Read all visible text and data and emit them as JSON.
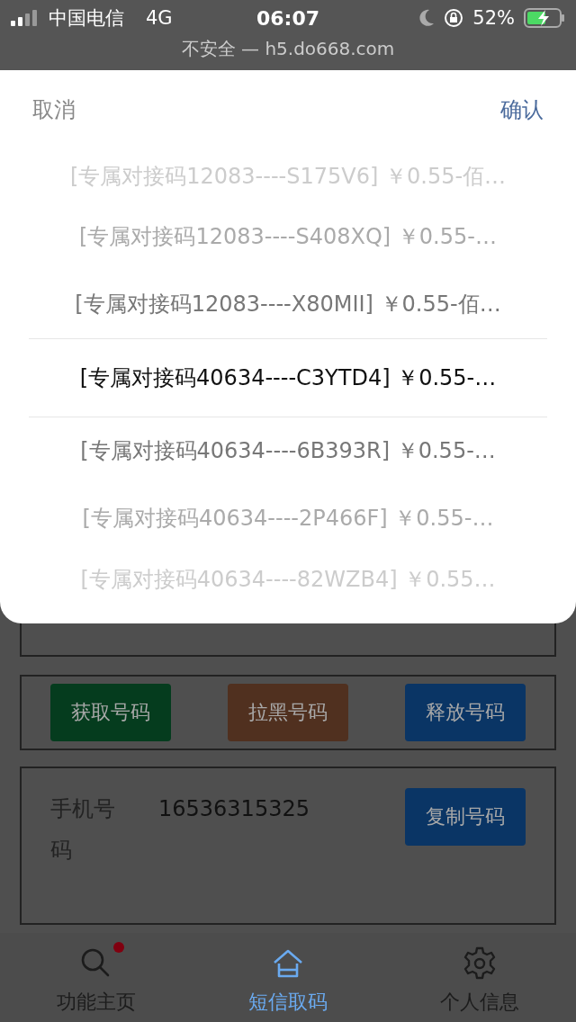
{
  "status_bar": {
    "carrier": "中国电信",
    "network": "4G",
    "time": "06:07",
    "battery": "52%"
  },
  "address_bar": {
    "text": "不安全 — h5.do668.com"
  },
  "picker": {
    "cancel": "取消",
    "confirm": "确认",
    "options": [
      {
        "label": "[专属对接码12083----S175V6] ￥0.55-佰…",
        "selected": false
      },
      {
        "label": "[专属对接码12083----S408XQ] ￥0.55-…",
        "selected": false
      },
      {
        "label": "[专属对接码12083----X80MII] ￥0.55-佰…",
        "selected": false
      },
      {
        "label": "[专属对接码40634----C3YTD4] ￥0.55-…",
        "selected": true
      },
      {
        "label": "[专属对接码40634----6B393R] ￥0.55-…",
        "selected": false
      },
      {
        "label": "[专属对接码40634----2P466F] ￥0.55-…",
        "selected": false
      },
      {
        "label": "[专属对接码40634----82WZB4] ￥0.55…",
        "selected": false
      }
    ]
  },
  "actions": [
    {
      "label": "获取号码",
      "color": "#053c1e"
    },
    {
      "label": "拉黑号码",
      "color": "#50301f"
    },
    {
      "label": "释放号码",
      "color": "#0a3565"
    }
  ],
  "phone": {
    "label": "手机号码",
    "value": "16536315325",
    "copy_button": "复制号码"
  },
  "tabs": [
    {
      "label": "功能主页",
      "kind": "search",
      "selected": false,
      "badge": true
    },
    {
      "label": "短信取码",
      "kind": "home",
      "selected": true,
      "badge": false
    },
    {
      "label": "个人信息",
      "kind": "settings",
      "selected": false,
      "badge": false
    }
  ]
}
